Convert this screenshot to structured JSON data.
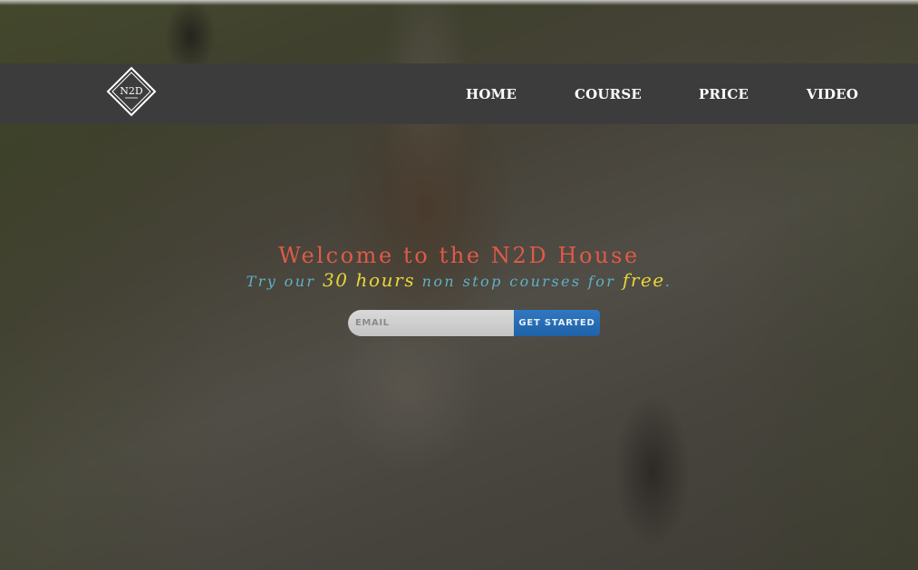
{
  "brand": {
    "logo_text": "N2D",
    "logo_icon": "diamond-logo-icon"
  },
  "nav": {
    "items": [
      {
        "label": "HOME"
      },
      {
        "label": "COURSE"
      },
      {
        "label": "PRICE"
      },
      {
        "label": "VIDEO"
      }
    ]
  },
  "hero": {
    "headline": "Welcome to the N2D House",
    "subline": {
      "part1": "Try our ",
      "highlight1": "30 hours",
      "part2": " non stop courses for ",
      "highlight2": "free",
      "part3": "."
    }
  },
  "signup": {
    "email_placeholder": "EMAIL",
    "email_value": "",
    "button_label": "GET STARTED"
  },
  "colors": {
    "navbar_bg": "#3d3c3c",
    "headline": "#e05a47",
    "subline_muted": "#5fb2c6",
    "subline_highlight": "#e8d53a",
    "cta_button": "#2f78c2"
  }
}
